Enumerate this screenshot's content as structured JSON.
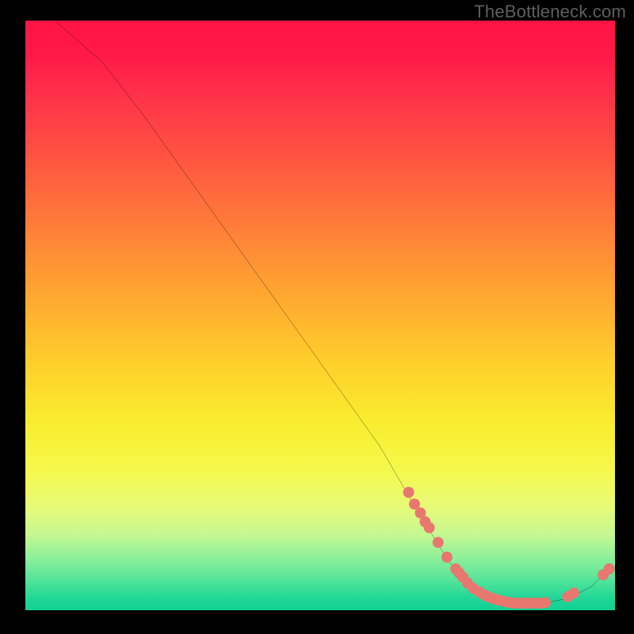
{
  "watermark": "TheBottleneck.com",
  "chart_data": {
    "type": "line",
    "title": "",
    "xlabel": "",
    "ylabel": "",
    "xlim": [
      0,
      100
    ],
    "ylim": [
      0,
      100
    ],
    "curve": {
      "name": "bottleneck-curve",
      "color": "#000000",
      "points": [
        {
          "x": 5,
          "y": 100
        },
        {
          "x": 13,
          "y": 93
        },
        {
          "x": 20,
          "y": 84
        },
        {
          "x": 30,
          "y": 70
        },
        {
          "x": 40,
          "y": 56
        },
        {
          "x": 50,
          "y": 42
        },
        {
          "x": 60,
          "y": 28
        },
        {
          "x": 67,
          "y": 16
        },
        {
          "x": 72,
          "y": 8
        },
        {
          "x": 77,
          "y": 3
        },
        {
          "x": 82,
          "y": 1.2
        },
        {
          "x": 88,
          "y": 1.2
        },
        {
          "x": 92,
          "y": 2
        },
        {
          "x": 96,
          "y": 4
        },
        {
          "x": 99,
          "y": 7
        }
      ]
    },
    "markers": {
      "name": "highlighted-points",
      "color": "#e8776f",
      "radius": 7,
      "points": [
        {
          "x": 65,
          "y": 20
        },
        {
          "x": 66,
          "y": 18
        },
        {
          "x": 67,
          "y": 16.5
        },
        {
          "x": 67.8,
          "y": 15
        },
        {
          "x": 68.5,
          "y": 14
        },
        {
          "x": 70,
          "y": 11.5
        },
        {
          "x": 71.5,
          "y": 9
        },
        {
          "x": 73,
          "y": 7
        },
        {
          "x": 73.6,
          "y": 6.3
        },
        {
          "x": 74.2,
          "y": 5.6
        },
        {
          "x": 75,
          "y": 4.6
        },
        {
          "x": 76,
          "y": 3.7
        },
        {
          "x": 77,
          "y": 3.1
        },
        {
          "x": 77.8,
          "y": 2.6
        },
        {
          "x": 78.5,
          "y": 2.3
        },
        {
          "x": 79.3,
          "y": 2.0
        },
        {
          "x": 80,
          "y": 1.8
        },
        {
          "x": 80.8,
          "y": 1.6
        },
        {
          "x": 81.6,
          "y": 1.4
        },
        {
          "x": 82.3,
          "y": 1.3
        },
        {
          "x": 83,
          "y": 1.2
        },
        {
          "x": 83.8,
          "y": 1.2
        },
        {
          "x": 84.5,
          "y": 1.2
        },
        {
          "x": 85.2,
          "y": 1.2
        },
        {
          "x": 86,
          "y": 1.2
        },
        {
          "x": 86.8,
          "y": 1.2
        },
        {
          "x": 87.5,
          "y": 1.2
        },
        {
          "x": 88.2,
          "y": 1.3
        },
        {
          "x": 92,
          "y": 2.3
        },
        {
          "x": 93,
          "y": 2.9
        },
        {
          "x": 98,
          "y": 6.0
        },
        {
          "x": 99,
          "y": 7.0
        }
      ]
    },
    "gradient_stops": [
      {
        "pos": 0.0,
        "color": "#ff1446"
      },
      {
        "pos": 0.22,
        "color": "#ff5042"
      },
      {
        "pos": 0.46,
        "color": "#ffa531"
      },
      {
        "pos": 0.68,
        "color": "#f9ec2f"
      },
      {
        "pos": 0.87,
        "color": "#c7f891"
      },
      {
        "pos": 1.0,
        "color": "#11d094"
      }
    ]
  }
}
